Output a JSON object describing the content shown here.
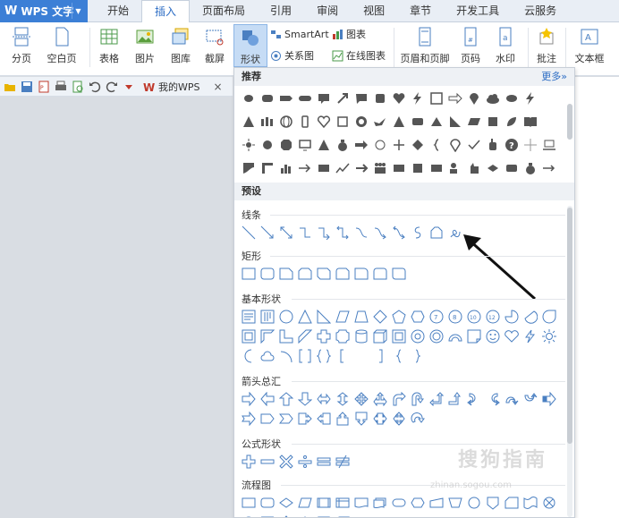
{
  "app": {
    "name": "WPS 文字",
    "logo": "W"
  },
  "menu_tabs": [
    "开始",
    "插入",
    "页面布局",
    "引用",
    "审阅",
    "视图",
    "章节",
    "开发工具",
    "云服务"
  ],
  "active_tab": "插入",
  "ribbon": {
    "page_break": "分页",
    "blank_page": "空白页",
    "table": "表格",
    "picture": "图片",
    "gallery": "图库",
    "screenshot": "截屏",
    "shapes": "形状",
    "smartart": "SmartArt",
    "chart": "图表",
    "relation": "关系图",
    "online_chart": "在线图表",
    "header_footer": "页眉和页脚",
    "page_number": "页码",
    "watermark": "水印",
    "comment": "批注",
    "textbox": "文本框"
  },
  "doc_tab": {
    "label": "我的WPS",
    "close": "×"
  },
  "panel": {
    "recommended": "推荐",
    "more": "更多»",
    "preset": "预设",
    "sections": [
      "线条",
      "矩形",
      "基本形状",
      "箭头总汇",
      "公式形状",
      "流程图"
    ]
  },
  "watermark_text": "搜狗指南",
  "watermark_url": "zhinan.sogou.com",
  "colors": {
    "accent": "#2b6cc4",
    "app": "#3c7fd6",
    "shape_outline": "#4a7fc1",
    "shape_fill": "#555555"
  }
}
